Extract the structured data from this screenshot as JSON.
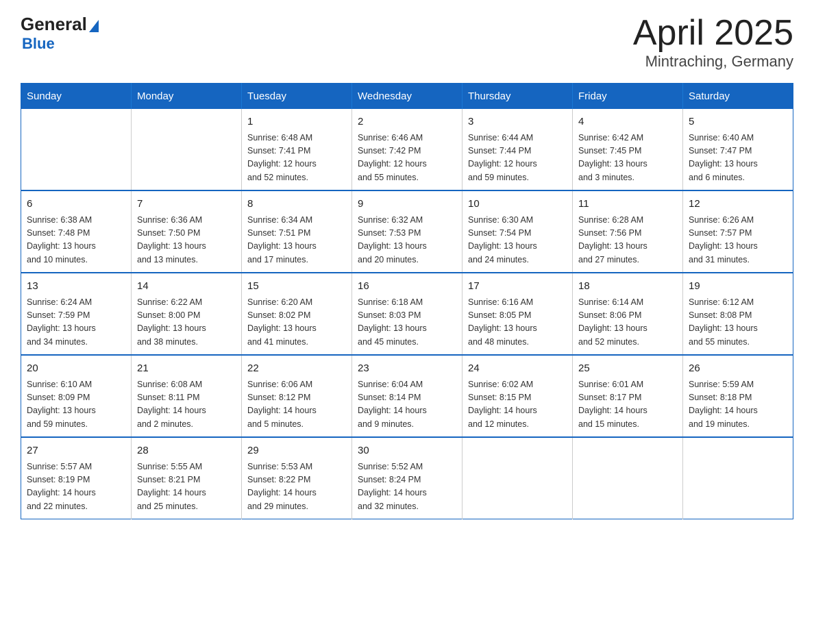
{
  "logo": {
    "text_general": "General",
    "text_blue": "Blue"
  },
  "title": {
    "month_year": "April 2025",
    "location": "Mintraching, Germany"
  },
  "weekdays": [
    "Sunday",
    "Monday",
    "Tuesday",
    "Wednesday",
    "Thursday",
    "Friday",
    "Saturday"
  ],
  "weeks": [
    [
      {
        "day": "",
        "info": ""
      },
      {
        "day": "",
        "info": ""
      },
      {
        "day": "1",
        "info": "Sunrise: 6:48 AM\nSunset: 7:41 PM\nDaylight: 12 hours\nand 52 minutes."
      },
      {
        "day": "2",
        "info": "Sunrise: 6:46 AM\nSunset: 7:42 PM\nDaylight: 12 hours\nand 55 minutes."
      },
      {
        "day": "3",
        "info": "Sunrise: 6:44 AM\nSunset: 7:44 PM\nDaylight: 12 hours\nand 59 minutes."
      },
      {
        "day": "4",
        "info": "Sunrise: 6:42 AM\nSunset: 7:45 PM\nDaylight: 13 hours\nand 3 minutes."
      },
      {
        "day": "5",
        "info": "Sunrise: 6:40 AM\nSunset: 7:47 PM\nDaylight: 13 hours\nand 6 minutes."
      }
    ],
    [
      {
        "day": "6",
        "info": "Sunrise: 6:38 AM\nSunset: 7:48 PM\nDaylight: 13 hours\nand 10 minutes."
      },
      {
        "day": "7",
        "info": "Sunrise: 6:36 AM\nSunset: 7:50 PM\nDaylight: 13 hours\nand 13 minutes."
      },
      {
        "day": "8",
        "info": "Sunrise: 6:34 AM\nSunset: 7:51 PM\nDaylight: 13 hours\nand 17 minutes."
      },
      {
        "day": "9",
        "info": "Sunrise: 6:32 AM\nSunset: 7:53 PM\nDaylight: 13 hours\nand 20 minutes."
      },
      {
        "day": "10",
        "info": "Sunrise: 6:30 AM\nSunset: 7:54 PM\nDaylight: 13 hours\nand 24 minutes."
      },
      {
        "day": "11",
        "info": "Sunrise: 6:28 AM\nSunset: 7:56 PM\nDaylight: 13 hours\nand 27 minutes."
      },
      {
        "day": "12",
        "info": "Sunrise: 6:26 AM\nSunset: 7:57 PM\nDaylight: 13 hours\nand 31 minutes."
      }
    ],
    [
      {
        "day": "13",
        "info": "Sunrise: 6:24 AM\nSunset: 7:59 PM\nDaylight: 13 hours\nand 34 minutes."
      },
      {
        "day": "14",
        "info": "Sunrise: 6:22 AM\nSunset: 8:00 PM\nDaylight: 13 hours\nand 38 minutes."
      },
      {
        "day": "15",
        "info": "Sunrise: 6:20 AM\nSunset: 8:02 PM\nDaylight: 13 hours\nand 41 minutes."
      },
      {
        "day": "16",
        "info": "Sunrise: 6:18 AM\nSunset: 8:03 PM\nDaylight: 13 hours\nand 45 minutes."
      },
      {
        "day": "17",
        "info": "Sunrise: 6:16 AM\nSunset: 8:05 PM\nDaylight: 13 hours\nand 48 minutes."
      },
      {
        "day": "18",
        "info": "Sunrise: 6:14 AM\nSunset: 8:06 PM\nDaylight: 13 hours\nand 52 minutes."
      },
      {
        "day": "19",
        "info": "Sunrise: 6:12 AM\nSunset: 8:08 PM\nDaylight: 13 hours\nand 55 minutes."
      }
    ],
    [
      {
        "day": "20",
        "info": "Sunrise: 6:10 AM\nSunset: 8:09 PM\nDaylight: 13 hours\nand 59 minutes."
      },
      {
        "day": "21",
        "info": "Sunrise: 6:08 AM\nSunset: 8:11 PM\nDaylight: 14 hours\nand 2 minutes."
      },
      {
        "day": "22",
        "info": "Sunrise: 6:06 AM\nSunset: 8:12 PM\nDaylight: 14 hours\nand 5 minutes."
      },
      {
        "day": "23",
        "info": "Sunrise: 6:04 AM\nSunset: 8:14 PM\nDaylight: 14 hours\nand 9 minutes."
      },
      {
        "day": "24",
        "info": "Sunrise: 6:02 AM\nSunset: 8:15 PM\nDaylight: 14 hours\nand 12 minutes."
      },
      {
        "day": "25",
        "info": "Sunrise: 6:01 AM\nSunset: 8:17 PM\nDaylight: 14 hours\nand 15 minutes."
      },
      {
        "day": "26",
        "info": "Sunrise: 5:59 AM\nSunset: 8:18 PM\nDaylight: 14 hours\nand 19 minutes."
      }
    ],
    [
      {
        "day": "27",
        "info": "Sunrise: 5:57 AM\nSunset: 8:19 PM\nDaylight: 14 hours\nand 22 minutes."
      },
      {
        "day": "28",
        "info": "Sunrise: 5:55 AM\nSunset: 8:21 PM\nDaylight: 14 hours\nand 25 minutes."
      },
      {
        "day": "29",
        "info": "Sunrise: 5:53 AM\nSunset: 8:22 PM\nDaylight: 14 hours\nand 29 minutes."
      },
      {
        "day": "30",
        "info": "Sunrise: 5:52 AM\nSunset: 8:24 PM\nDaylight: 14 hours\nand 32 minutes."
      },
      {
        "day": "",
        "info": ""
      },
      {
        "day": "",
        "info": ""
      },
      {
        "day": "",
        "info": ""
      }
    ]
  ]
}
